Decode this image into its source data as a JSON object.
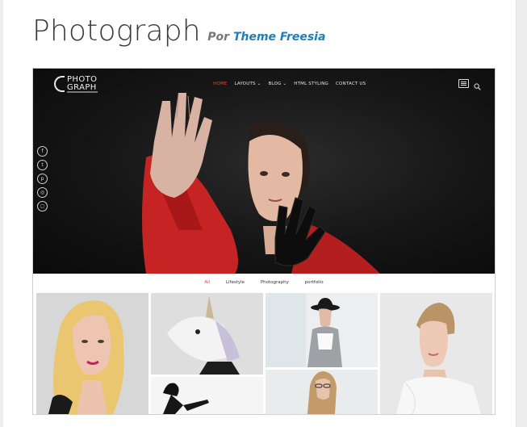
{
  "theme": {
    "title": "Photograph",
    "by": "Por",
    "author": "Theme Freesia"
  },
  "preview": {
    "logo": {
      "line1": "PHOTO",
      "line2": "GRAPH"
    },
    "nav": [
      {
        "label": "HOME",
        "active": true
      },
      {
        "label": "LAYOUTS ⌄",
        "active": false
      },
      {
        "label": "BLOG ⌄",
        "active": false
      },
      {
        "label": "HTML STYLING",
        "active": false
      },
      {
        "label": "CONTACT US",
        "active": false
      }
    ],
    "social_icons": [
      "facebook-icon",
      "twitter-icon",
      "pinterest-icon",
      "dribbble-icon",
      "instagram-icon"
    ],
    "social_glyphs": [
      "f",
      "t",
      "p",
      "◎",
      "◻"
    ],
    "filters": [
      {
        "label": "All",
        "active": true
      },
      {
        "label": "Lifestyle",
        "active": false
      },
      {
        "label": "Photography",
        "active": false
      },
      {
        "label": "portfolio",
        "active": false
      }
    ],
    "colors": {
      "accent": "#e8452c",
      "author_link": "#1d7fb8",
      "hero_bg": "#151515"
    }
  }
}
